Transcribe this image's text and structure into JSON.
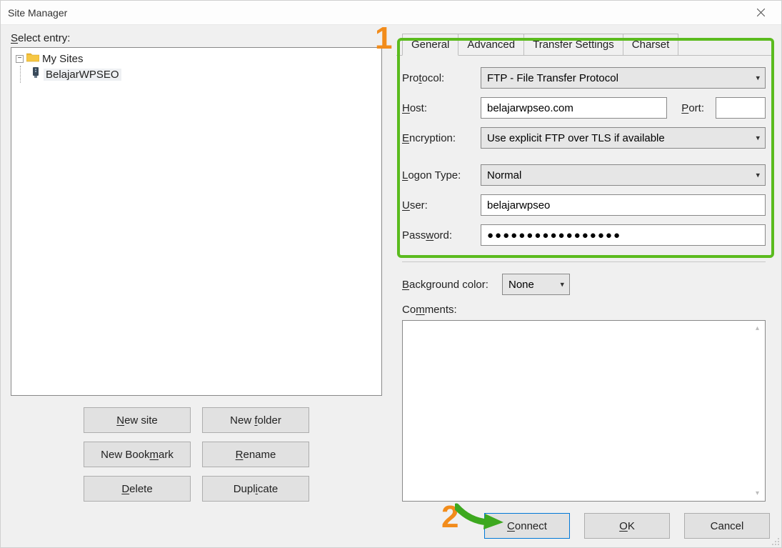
{
  "window": {
    "title": "Site Manager"
  },
  "left": {
    "select_label": "Select entry:",
    "root_label": "My Sites",
    "child_label": "BelajarWPSEO",
    "buttons": {
      "new_site": "New site",
      "new_folder": "New folder",
      "new_bookmark": "New Bookmark",
      "rename": "Rename",
      "delete": "Delete",
      "duplicate": "Duplicate"
    }
  },
  "tabs": {
    "general": "General",
    "advanced": "Advanced",
    "transfer": "Transfer Settings",
    "charset": "Charset"
  },
  "form": {
    "protocol_label": "Protocol:",
    "protocol_value": "FTP - File Transfer Protocol",
    "host_label": "Host:",
    "host_value": "belajarwpseo.com",
    "port_label": "Port:",
    "port_value": "",
    "encryption_label": "Encryption:",
    "encryption_value": "Use explicit FTP over TLS if available",
    "logon_label": "Logon Type:",
    "logon_value": "Normal",
    "user_label": "User:",
    "user_value": "belajarwpseo",
    "password_label": "Password:",
    "password_value": "●●●●●●●●●●●●●●●●●",
    "bgcolor_label": "Background color:",
    "bgcolor_value": "None",
    "comments_label": "Comments:"
  },
  "footer": {
    "connect": "Connect",
    "ok": "OK",
    "cancel": "Cancel"
  },
  "annotations": {
    "one": "1",
    "two": "2"
  }
}
